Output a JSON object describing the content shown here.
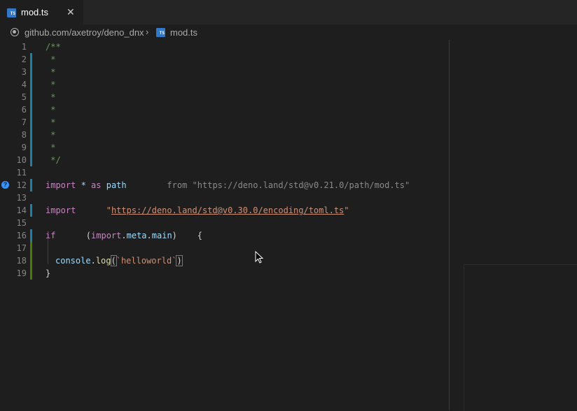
{
  "tab": {
    "label": "mod.ts",
    "close": "✕",
    "icon": "TS"
  },
  "breadcrumb": {
    "repo": "github.com/axetroy/deno_dnx",
    "sep": "›",
    "file": "mod.ts",
    "icon": "TS"
  },
  "lines": [
    "1",
    "2",
    "3",
    "4",
    "5",
    "6",
    "7",
    "8",
    "9",
    "10",
    "11",
    "12",
    "13",
    "14",
    "15",
    "16",
    "17",
    "18",
    "19"
  ],
  "code": {
    "l1": "/**",
    "star": " *",
    "l10": " */",
    "l12": {
      "kw1": "import",
      "star": " * ",
      "as": "as",
      "name": " path",
      "from": "        from",
      "url": " \"https://deno.land/std@v0.21.0/path/mod.ts\""
    },
    "l14": {
      "kw": "import",
      "q1": "      \"",
      "url": "https://deno.land/std@v0.30.0/encoding/toml.ts",
      "q2": "\""
    },
    "l16": {
      "kw": "if",
      "p1": "      (",
      "imp": "import",
      "d1": ".",
      "meta": "meta",
      "d2": ".",
      "main": "main",
      "p2": ")",
      "brace": "    {"
    },
    "l18": {
      "obj": "console",
      "dot": ".",
      "fn": "log",
      "po": "(",
      "str": "`helloworld`",
      "pc": ")"
    },
    "l19": "}"
  },
  "hint": "?"
}
